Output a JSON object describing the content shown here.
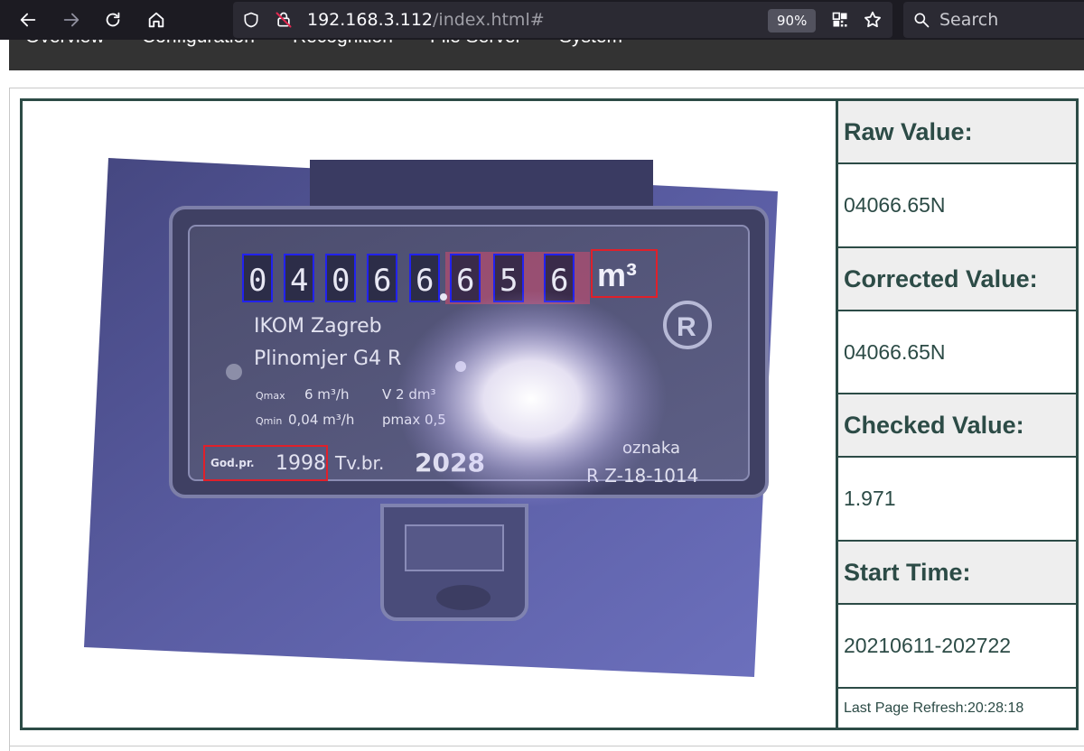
{
  "browser": {
    "url_host": "192.168.3.112",
    "url_path": "/index.html#",
    "zoom": "90%",
    "search_placeholder": "Search"
  },
  "menu": {
    "items": [
      "Overview",
      "Configuration",
      "Recognition",
      "File Server",
      "System"
    ]
  },
  "meter_photo": {
    "digits": [
      "0",
      "4",
      "0",
      "6",
      "6",
      "6",
      "5",
      "6"
    ],
    "unit": "m³",
    "text_line1": "IKOM Zagreb",
    "text_line2": "Plinomjer G4 R",
    "spec_qmax": "Qmax",
    "spec_qmax_val": "6 m³/h",
    "spec_v": "V 2 dm³",
    "spec_qmin": "Qmin",
    "spec_qmin_val": "0,04 m³/h",
    "spec_pmax": "pmax 0,5",
    "year_label": "God.pr.",
    "year_value": "1998",
    "serial_label": "Tv.br.",
    "serial_value": "2028",
    "mark_label": "oznaka",
    "mark_value": "R Z-18-1014",
    "badge": "R"
  },
  "values": {
    "raw_label": "Raw Value:",
    "raw_value": "04066.65N",
    "corrected_label": "Corrected Value:",
    "corrected_value": "04066.65N",
    "checked_label": "Checked Value:",
    "checked_value": "1.971",
    "start_label": "Start Time:",
    "start_value": "20210611-202722",
    "refresh_text": "Last Page Refresh:20:28:18"
  },
  "colors": {
    "browser_bg": "#1c1b22",
    "table_border": "#2c4b46",
    "roi_digit": "#1a1aff",
    "roi_analog": "#e0202a"
  }
}
